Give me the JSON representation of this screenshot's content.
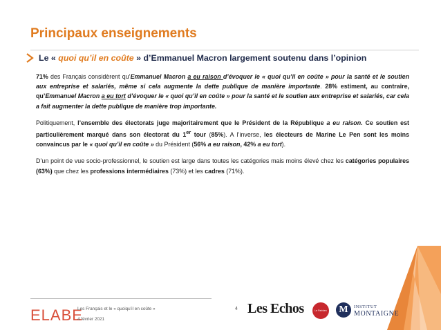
{
  "header": {
    "title": "Principaux enseignements",
    "subtitle_prefix": "Le « ",
    "subtitle_quote": "quoi qu’il en coûte",
    "subtitle_suffix": " » d’Emmanuel Macron largement soutenu dans l’opinion"
  },
  "body": {
    "p1": {
      "pct1": "71%",
      "t1": " des Français considèrent qu’",
      "macron1": "Emmanuel Macron",
      "sp1": " ",
      "raison": "a eu raison ",
      "t2": "d’évoquer le « quoi qu’il en coûte » pour la santé et le soutien aux entreprise et salariés, même si cela augmente la dette publique de manière importante",
      "t3": ". ",
      "pct2": "28%",
      "t4": " estiment, au contraire, qu’",
      "macron2": "Emmanuel Macron",
      "sp2": " ",
      "tort": "a eu tort",
      "t5": " d’évoquer le « quoi qu’il en coûte » pour la santé et le soutien aux entreprise et salariés, car cela a fait augmenter la dette publique de manière trop importante."
    },
    "p2": {
      "t1": "Politiquement, ",
      "b1": "l’ensemble des électorats juge majoritairement que le Président de la République ",
      "b1i": "a eu raison",
      "b2": ". Ce soutien est particulièrement marqué dans son électorat du 1",
      "sup": "er",
      "b3": " tour",
      "t2": " (",
      "b4": "85%",
      "t3": "). A l’inverse, ",
      "b5": "les électeurs de Marine Le Pen sont les moins convaincus par le ",
      "b5i": "« quoi qu’il en coûte »",
      "t4": " du Président (",
      "b6": "56% ",
      "b6i1": "a eu raison",
      "b7": ", 42% ",
      "b7i": "a eu tort",
      "t5": ")."
    },
    "p3": {
      "t1": "D’un point de vue socio-professionnel, le soutien est large dans toutes les catégories mais moins élevé chez les ",
      "b1": "catégories populaires (63%)",
      "t2": " que chez les ",
      "b2": "professions intermédiaires",
      "t3": " (73%) et les ",
      "b3": "cadres",
      "t4": " (71%)."
    }
  },
  "footer": {
    "brand": "ELABE",
    "study": "Les Français et le « quoiqu’il en coûte »",
    "date": "4 février 2021",
    "page_number": "4",
    "partner1": "Les Echos",
    "partner2_line1": "INSTITUT",
    "partner2_line2": "MONTAIGNE",
    "partner2_initial": "M",
    "badge_text": "Le Parisien"
  },
  "colors": {
    "accent": "#e07b1f",
    "navy": "#1f2a4a",
    "brand_red": "#d94f3a"
  }
}
